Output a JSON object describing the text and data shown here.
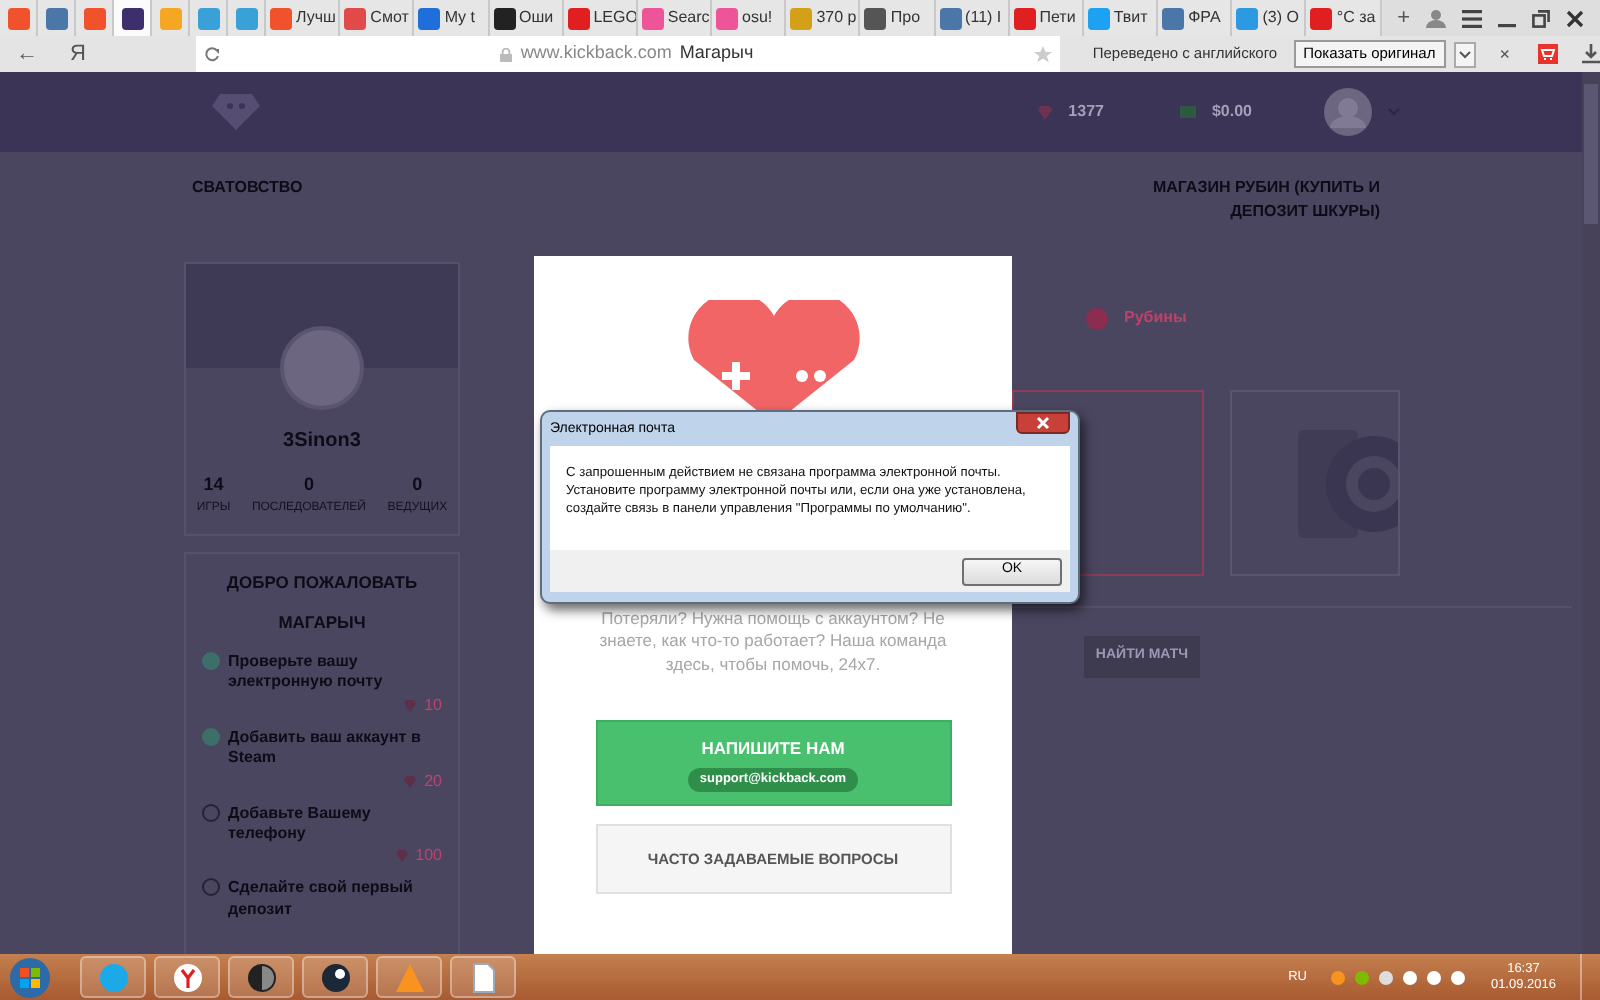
{
  "browser": {
    "tabs": [
      {
        "color": "#f0532c",
        "selected": false
      },
      {
        "color": "#4a76a8",
        "selected": false
      },
      {
        "color": "#f0532c",
        "selected": false
      },
      {
        "color": "#3d2f6b",
        "selected": true
      },
      {
        "color": "#f5a623",
        "selected": false
      },
      {
        "color": "#3aa0d8",
        "selected": false
      },
      {
        "color": "#3aa0d8",
        "selected": false
      },
      {
        "label": "Лучш",
        "color": "#f0532c",
        "selected": false
      },
      {
        "label": "Смот",
        "color": "#e24a4a",
        "selected": false
      },
      {
        "label": "My t",
        "color": "#1e6fd9",
        "selected": false
      },
      {
        "label": "Оши",
        "color": "#222222",
        "selected": false
      },
      {
        "label": "LEGO",
        "color": "#e02020",
        "selected": false
      },
      {
        "label": "Searc",
        "color": "#ee5599",
        "selected": false
      },
      {
        "label": "osu!",
        "color": "#ee5599",
        "selected": false
      },
      {
        "label": "370 р",
        "color": "#d4a017",
        "selected": false
      },
      {
        "label": "Про",
        "color": "#555555",
        "selected": false
      },
      {
        "label": "(11) I",
        "color": "#4a76a8",
        "selected": false
      },
      {
        "label": "Пети",
        "color": "#e02020",
        "selected": false
      },
      {
        "label": "Твит",
        "color": "#1da1f2",
        "selected": false
      },
      {
        "label": "ФРА",
        "color": "#4a76a8",
        "selected": false
      },
      {
        "label": "(3) О",
        "color": "#2b9ae0",
        "selected": false
      },
      {
        "label": "°C за",
        "color": "#e02020",
        "selected": false
      }
    ],
    "new_tab": "+",
    "address_bar": {
      "back": "←",
      "brand": "Я",
      "url": "www.kickback.com",
      "page_title": "Магарыч"
    },
    "translate_bar": {
      "message": "Переведено с английского",
      "button": "Показать оригинал",
      "close": "×"
    }
  },
  "site": {
    "header": {
      "rubies": "1377",
      "balance": "$0.00"
    },
    "nav": {
      "left": "СВАТОВСТВО",
      "right": "МАГАЗИН РУБИН (КУПИТЬ И ДЕПОЗИТ ШКУРЫ)"
    },
    "profile": {
      "name": "3Sinon3",
      "stats": [
        {
          "value": "14",
          "label": "ИГРЫ"
        },
        {
          "value": "0",
          "label": "ПОСЛЕДОВАТЕЛЕЙ"
        },
        {
          "value": "0",
          "label": "ВЕДУЩИХ"
        }
      ]
    },
    "welcome": {
      "title": "ДОБРО ПОЖАЛОВАТЬ",
      "name": "МАГАРЫЧ",
      "tasks": [
        {
          "label": "Проверьте вашу электронную почту",
          "reward": "10",
          "checked": true
        },
        {
          "label": "Добавить ваш аккаунт в Steam",
          "reward": "20",
          "checked": true
        },
        {
          "label": "Добавьте Вашему телефону",
          "reward": "100",
          "checked": false
        },
        {
          "label": "Сделайте свой первый депозит",
          "checked": false
        }
      ]
    },
    "currency_options": [
      {
        "label": "Рубины",
        "selected": true
      }
    ],
    "find_match": "НАЙТИ МАТЧ"
  },
  "help_modal": {
    "text": "Потеряли? Нужна помощь с аккаунтом? Не знаете, как что-то работает? Наша команда здесь, чтобы помочь, 24x7.",
    "contact_button": "НАПИШИТЕ НАМ",
    "email": "support@kickback.com",
    "faq_button": "ЧАСТО ЗАДАВАЕМЫЕ ВОПРОСЫ"
  },
  "dialog": {
    "title": "Электронная почта",
    "message": "С запрошенным действием не связана программа электронной почты. Установите программу электронной почты или, если она уже установлена, создайте связь в панели управления \"Программы по умолчанию\".",
    "ok": "OK"
  },
  "taskbar": {
    "language": "RU",
    "time": "16:37",
    "date": "01.09.2016"
  }
}
